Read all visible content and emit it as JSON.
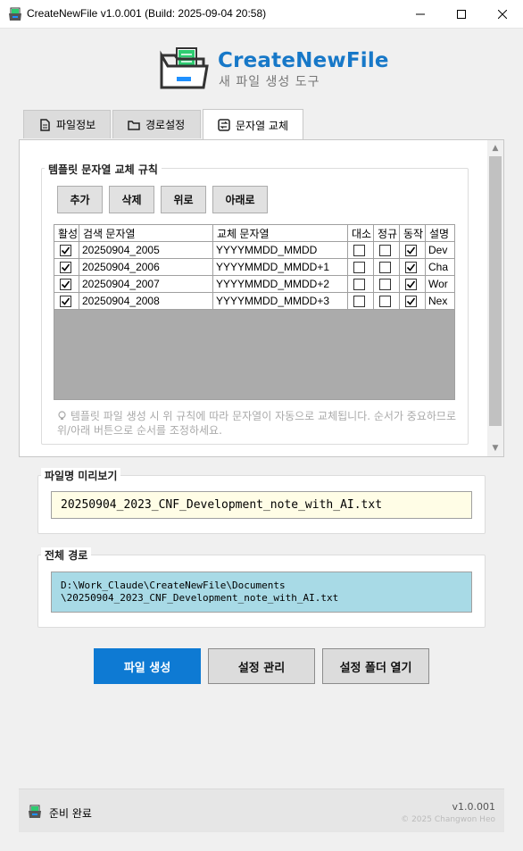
{
  "window": {
    "title": "CreateNewFile v1.0.001 (Build: 2025-09-04 20:58)",
    "minimize_icon": "minimize-icon",
    "maximize_icon": "maximize-icon",
    "close_icon": "close-icon"
  },
  "header": {
    "app_name": "CreateNewFile",
    "subtitle": "새 파일 생성 도구",
    "logo_icon": "folder-document-icon"
  },
  "tabs": [
    {
      "label": "파일정보",
      "icon": "file-icon",
      "active": false
    },
    {
      "label": "경로설정",
      "icon": "folder-icon",
      "active": false
    },
    {
      "label": "문자열 교체",
      "icon": "replace-icon",
      "active": true
    }
  ],
  "rules": {
    "group_title": "템플릿 문자열 교체 규칙",
    "buttons": {
      "add": "추가",
      "delete": "삭제",
      "up": "위로",
      "down": "아래로"
    },
    "columns": [
      "활성",
      "검색 문자열",
      "교체 문자열",
      "대소",
      "정규",
      "동작",
      "설명"
    ],
    "rows": [
      {
        "enabled": true,
        "search": "20250904_2005",
        "replace": "YYYYMMDD_MMDD",
        "case": false,
        "regex": false,
        "active": true,
        "desc": "Dev"
      },
      {
        "enabled": true,
        "search": "20250904_2006",
        "replace": "YYYYMMDD_MMDD+1",
        "case": false,
        "regex": false,
        "active": true,
        "desc": "Cha"
      },
      {
        "enabled": true,
        "search": "20250904_2007",
        "replace": "YYYYMMDD_MMDD+2",
        "case": false,
        "regex": false,
        "active": true,
        "desc": "Wor"
      },
      {
        "enabled": true,
        "search": "20250904_2008",
        "replace": "YYYYMMDD_MMDD+3",
        "case": false,
        "regex": false,
        "active": true,
        "desc": "Nex"
      }
    ],
    "hint": "템플릿 파일 생성 시 위 규칙에 따라 문자열이 자동으로 교체됩니다. 순서가 중요하므로 위/아래 버튼으로 순서를 조정하세요.",
    "hint_icon": "lightbulb-icon"
  },
  "preview": {
    "label": "파일명 미리보기",
    "value": "20250904_2023_CNF_Development_note_with_AI.txt"
  },
  "full_path": {
    "label": "전체 경로",
    "line1": "D:\\Work_Claude\\CreateNewFile\\Documents",
    "line2": "\\20250904_2023_CNF_Development_note_with_AI.txt"
  },
  "actions": {
    "create": "파일 생성",
    "settings": "설정 관리",
    "open_folder": "설정 폴더 열기"
  },
  "status": {
    "text": "준비 완료",
    "version": "v1.0.001",
    "copyright": "© 2025 Changwon Heo"
  },
  "colors": {
    "brand": "#1778c8",
    "primary_button": "#0e7ad3",
    "preview_bg": "#fffde6",
    "path_bg": "#a8dae6"
  }
}
